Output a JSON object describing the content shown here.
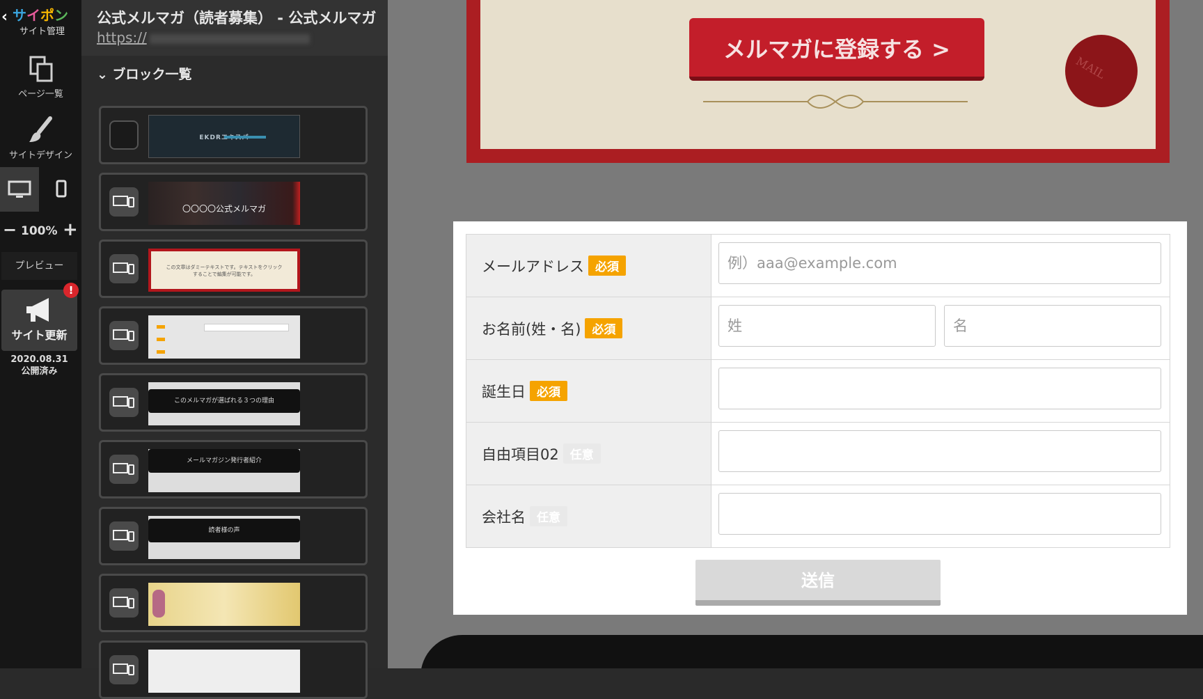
{
  "rail": {
    "logo": [
      "サ",
      "イ",
      "ポ",
      "ン"
    ],
    "logo_sub": "サイト管理",
    "pages_label": "ページ一覧",
    "design_label": "サイトデザイン",
    "zoom_value": "100%",
    "preview_label": "プレビュー",
    "update_label": "サイト更新",
    "update_badge": "!",
    "publish_date": "2020.08.31",
    "publish_status": "公開済み"
  },
  "panel": {
    "page_title": "公式メルマガ（読者募集） - 公式メルマガ",
    "page_url": "https://",
    "blocks_heading": "ブロック一覧",
    "blocks": [
      {
        "thumb_text": "EKDRエキスパ",
        "style": "dark"
      },
      {
        "thumb_text": "〇〇〇〇公式メルマガ",
        "style": "books"
      },
      {
        "thumb_text": "この文章はダミーテキストです。テキストをクリックすることで編集が可能です。",
        "style": "cert"
      },
      {
        "thumb_text": "",
        "style": "form"
      },
      {
        "thumb_text": "このメルマガが選ばれる３つの理由",
        "style": "banner"
      },
      {
        "thumb_text": "メールマガジン発行者紹介",
        "style": "banner"
      },
      {
        "thumb_text": "読者様の声",
        "style": "banner"
      },
      {
        "thumb_text": "",
        "style": "gold"
      },
      {
        "thumb_text": "",
        "style": "light"
      }
    ]
  },
  "preview": {
    "cert_button": "メルマガに登録する >",
    "seal_text": "MAIL",
    "form": {
      "rows": [
        {
          "label": "メールアドレス",
          "tag": "必須",
          "required": true,
          "placeholders": [
            "例）aaa@example.com"
          ]
        },
        {
          "label": "お名前(姓・名)",
          "tag": "必須",
          "required": true,
          "placeholders": [
            "姓",
            "名"
          ]
        },
        {
          "label": "誕生日",
          "tag": "必須",
          "required": true,
          "placeholders": [
            ""
          ]
        },
        {
          "label": "自由項目02",
          "tag": "任意",
          "required": false,
          "placeholders": [
            ""
          ]
        },
        {
          "label": "会社名",
          "tag": "任意",
          "required": false,
          "placeholders": [
            ""
          ]
        }
      ],
      "submit": "送信"
    }
  },
  "colors": {
    "required_tag": "#f5a300",
    "optional_tag": "#e9e9e9",
    "cert_red": "#c31e2a",
    "badge_red": "#d9262c"
  }
}
